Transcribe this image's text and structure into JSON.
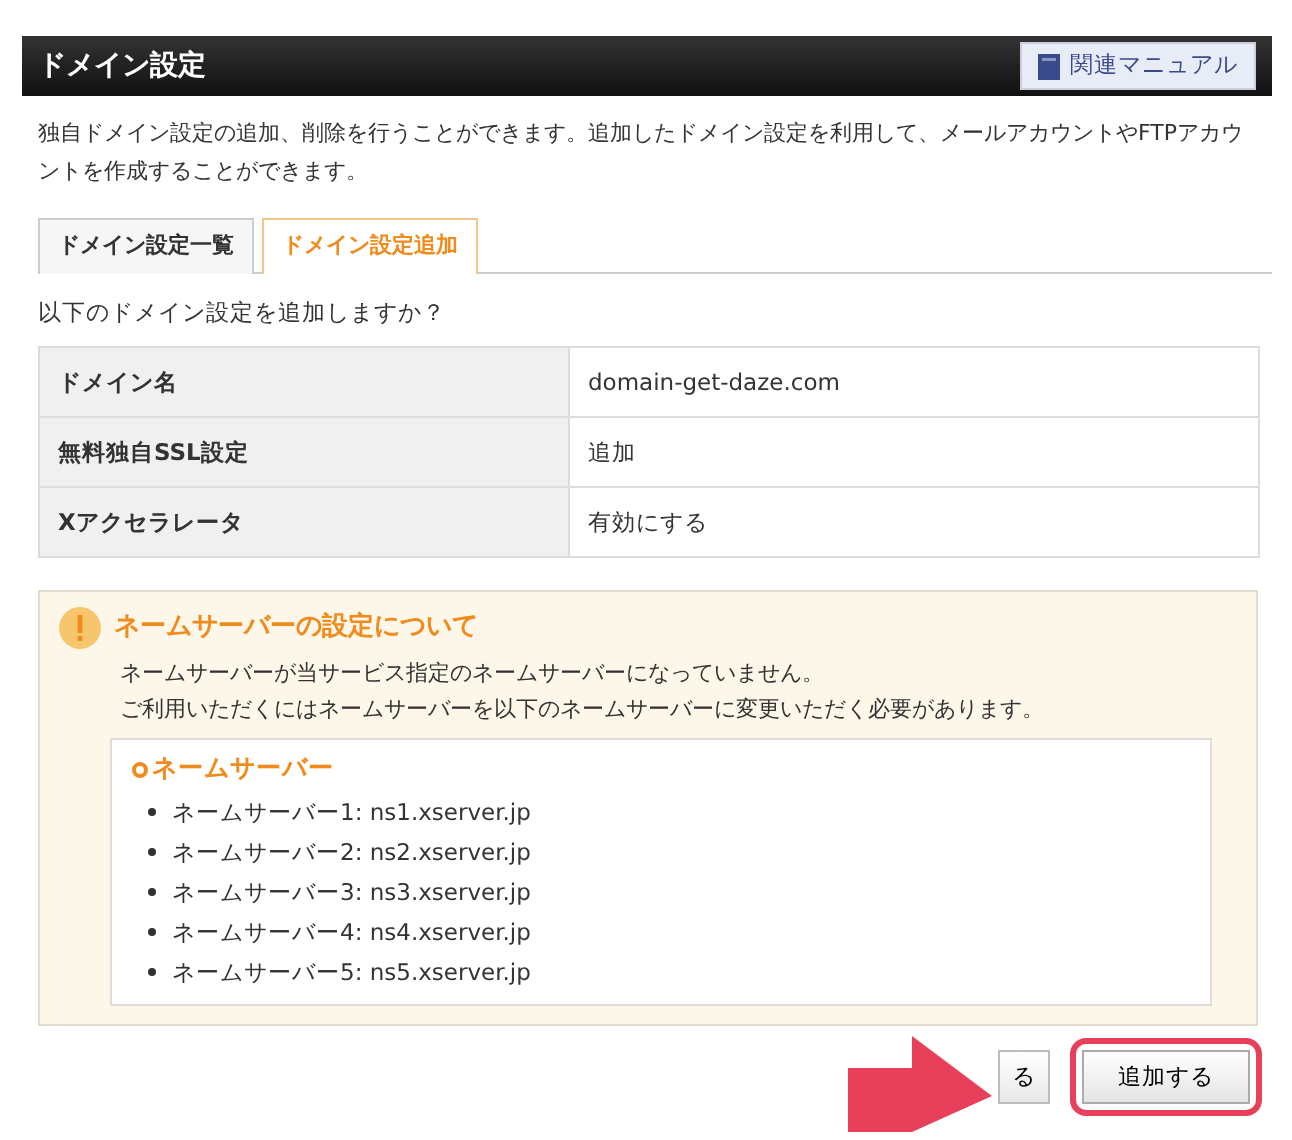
{
  "header": {
    "title": "ドメイン設定",
    "manual_button": "関連マニュアル"
  },
  "description": "独自ドメイン設定の追加、削除を行うことができます。追加したドメイン設定を利用して、メールアカウントやFTPアカウントを作成することができます。",
  "tabs": [
    {
      "label": "ドメイン設定一覧",
      "selected": false
    },
    {
      "label": "ドメイン設定追加",
      "selected": true
    }
  ],
  "question": "以下のドメイン設定を追加しますか？",
  "table": {
    "rows": [
      {
        "label": "ドメイン名",
        "value": "domain-get-daze.com"
      },
      {
        "label": "無料独自SSL設定",
        "value": "追加"
      },
      {
        "label": "Xアクセラレータ",
        "value": "有効にする"
      }
    ]
  },
  "notice": {
    "title": "ネームサーバーの設定について",
    "lines": [
      "ネームサーバーが当サービス指定のネームサーバーになっていません。",
      "ご利用いただくにはネームサーバーを以下のネームサーバーに変更いただく必要があります。"
    ],
    "list_title": "ネームサーバー",
    "servers": [
      "ネームサーバー1: ns1.xserver.jp",
      "ネームサーバー2: ns2.xserver.jp",
      "ネームサーバー3: ns3.xserver.jp",
      "ネームサーバー4: ns4.xserver.jp",
      "ネームサーバー5: ns5.xserver.jp"
    ]
  },
  "buttons": [
    {
      "label": "る",
      "kind": "back"
    },
    {
      "label": "追加する",
      "kind": "submit",
      "highlighted": true
    }
  ]
}
